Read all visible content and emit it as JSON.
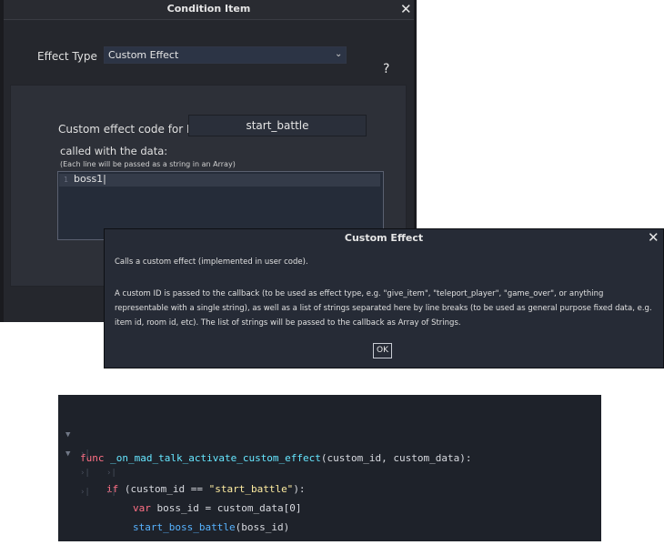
{
  "condition_window": {
    "title": "Condition Item",
    "close_glyph": "✕",
    "effect_type_label": "Effect Type",
    "effect_type_value": "Custom Effect",
    "help_label": "?",
    "custom_id_label": "Custom effect code for ID",
    "custom_id_value": "start_battle",
    "data_label": "called with the data:",
    "data_hint": "(Each line will be passed as a string in an Array)",
    "editor": {
      "line_number": "1",
      "text": "boss1|"
    }
  },
  "help_dialog": {
    "title": "Custom Effect",
    "close_glyph": "✕",
    "paragraph1": "Calls a custom effect (implemented in user code).",
    "paragraph2": "A custom ID is passed to the callback (to be used as effect type, e.g. \"give_item\", \"teleport_player\", \"game_over\", or anything representable with a single string), as well as a list of strings separated here by line breaks (to be used as general purpose fixed data, e.g. item id, room id, etc). The list of strings will be passed to the callback as Array of Strings.",
    "ok_label": "OK"
  },
  "code": {
    "lines": [
      {
        "kw": "func",
        "fn": "_on_mad_talk_activate_custom_effect",
        "rest": "(custom_id, custom_data):"
      },
      {
        "kw": "if",
        "pre": " (custom_id == ",
        "str": "\"start_battle\"",
        "rest": "):"
      },
      {
        "kw": "var",
        "rest": " boss_id = custom_data[0]"
      },
      {
        "fn": "start_boss_battle",
        "rest": "(boss_id)"
      }
    ]
  },
  "icons": [
    "close-icon",
    "chevron-down-icon",
    "fold-arrow-icon",
    "tab-indent-icon"
  ]
}
